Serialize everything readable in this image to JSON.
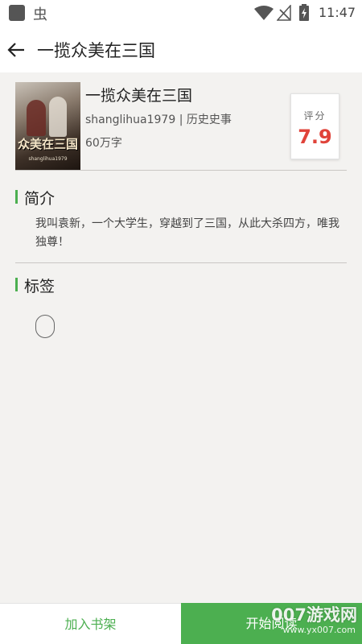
{
  "status_bar": {
    "time": "11:47",
    "left_icons": [
      "app-square-icon",
      "bug-icon"
    ],
    "right_icons": [
      "wifi-icon",
      "no-signal-icon",
      "battery-charging-icon"
    ]
  },
  "app_bar": {
    "title": "一揽众美在三国",
    "back_icon": "arrow-left-icon"
  },
  "book": {
    "cover_title": "众美在三国",
    "cover_author": "shanglihua1979",
    "title": "一揽众美在三国",
    "meta": "shanglihua1979 | 历史史事",
    "word_count": "60万字",
    "score_label": "评分",
    "score_value": "7.9"
  },
  "intro": {
    "heading": "简介",
    "text": "我叫袁新，一个大学生，穿越到了三国，从此大杀四方，唯我独尊！"
  },
  "tags": {
    "heading": "标签",
    "items": [
      ""
    ]
  },
  "actions": {
    "add_shelf": "加入书架",
    "start_reading": "开始阅读"
  },
  "watermark": {
    "text": "007游戏网",
    "url": "www.yx007.com"
  },
  "colors": {
    "accent": "#4caf50",
    "score": "#e0433a",
    "background": "#f3f2f0"
  }
}
